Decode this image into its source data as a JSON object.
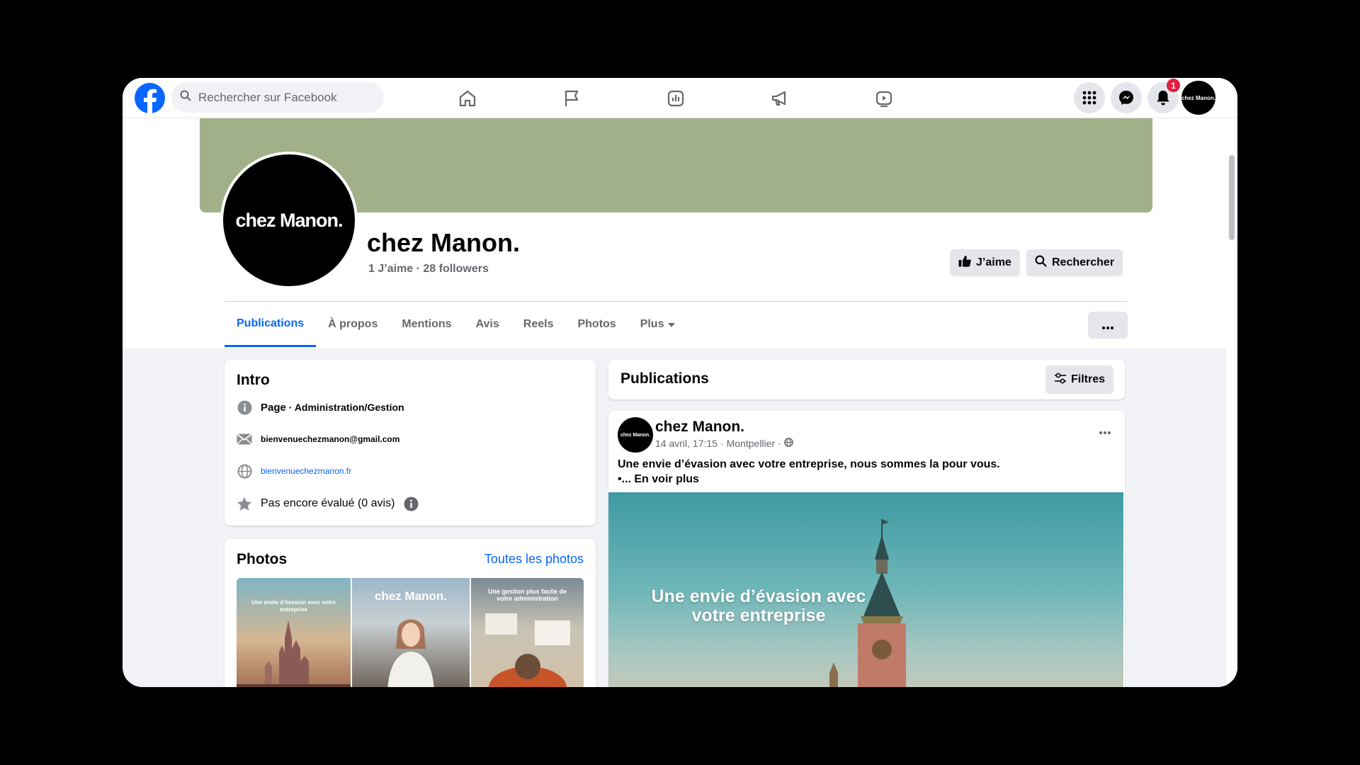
{
  "topbar": {
    "search_placeholder": "Rechercher sur Facebook",
    "notifications_count": "1",
    "account_avatar_text": "chez Manon."
  },
  "page": {
    "name": "chez Manon.",
    "profile_pic_text": "chez Manon.",
    "likes": "1 J’aime",
    "separator": "·",
    "followers": "28 followers",
    "like_button": "J’aime",
    "search_button": "Rechercher",
    "cover_color": "#a1b089"
  },
  "tabs": [
    {
      "label": "Publications"
    },
    {
      "label": "À propos"
    },
    {
      "label": "Mentions"
    },
    {
      "label": "Avis"
    },
    {
      "label": "Reels"
    },
    {
      "label": "Photos"
    },
    {
      "label": "Plus"
    }
  ],
  "intro": {
    "title": "Intro",
    "category_prefix": "Page",
    "category": " · Administration/Gestion",
    "email": "bienvenuechezmanon@gmail.com",
    "website": "bienvenuechezmanon.fr",
    "rating": "Pas encore évalué (0 avis)"
  },
  "photos": {
    "title": "Photos",
    "see_all": "Toutes les photos",
    "items": [
      {
        "caption": "Une envie d’évasion avec votre entreprise"
      },
      {
        "caption": "chez Manon."
      },
      {
        "caption": "Une gestion plus facile de votre administration"
      }
    ]
  },
  "publications": {
    "title": "Publications",
    "filter_label": "Filtres"
  },
  "post": {
    "author": "chez Manon.",
    "avatar_text": "chez Manon.",
    "date": "14 avril, 17:15",
    "location": "Montpellier",
    "meta_separator": "·",
    "text_line1": "Une envie d’évasion avec votre entreprise, nous sommes la pour vous.",
    "text_line2": "•... En voir plus",
    "image_text": "Une envie d’évasion avec votre entreprise"
  },
  "colors": {
    "accent": "#0866ff",
    "badge": "#e41e3f"
  }
}
